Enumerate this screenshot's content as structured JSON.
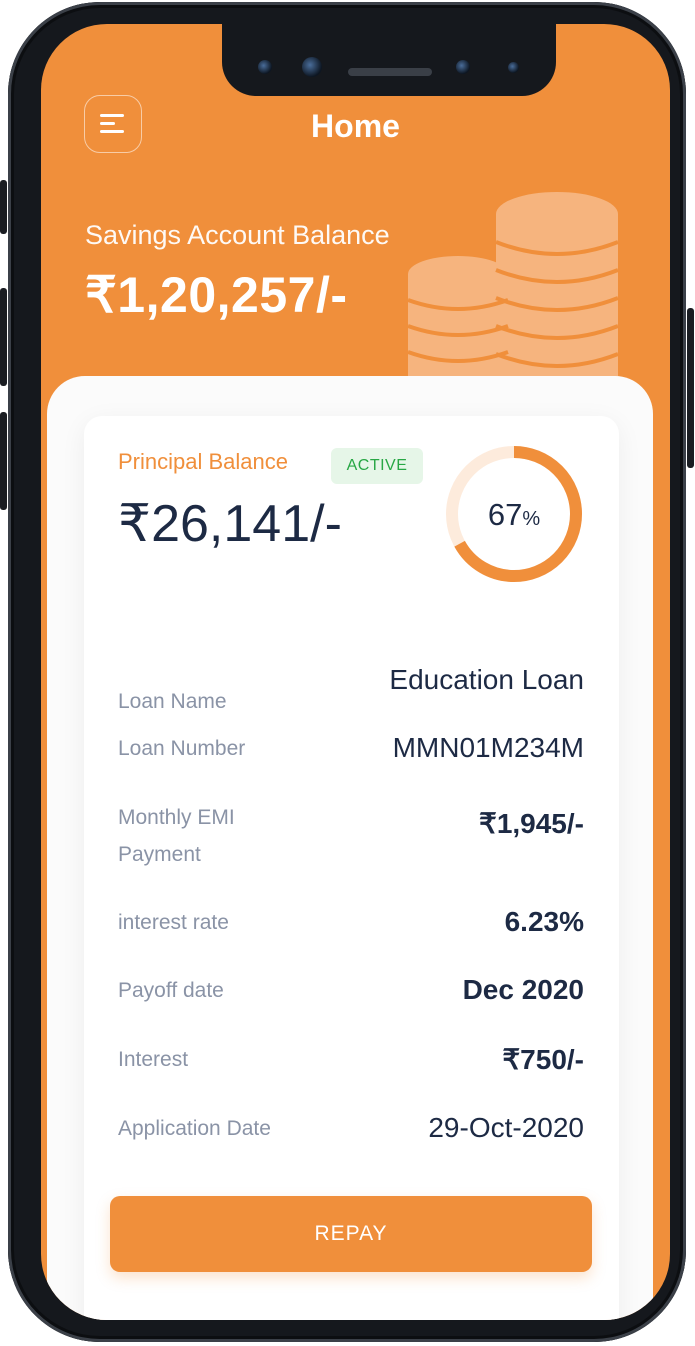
{
  "header": {
    "title": "Home"
  },
  "savings": {
    "label": "Savings Account Balance",
    "amount": "₹1,20,257/-"
  },
  "loan": {
    "principal_label": "Principal Balance",
    "status": "ACTIVE",
    "principal_amount": "₹26,141/-",
    "progress_percent": 67,
    "progress_number": "67",
    "progress_unit": "%"
  },
  "details": [
    {
      "label": "Loan Name",
      "value": "Education Loan"
    },
    {
      "label": "Loan Number",
      "value": "MMN01M234M"
    },
    {
      "label": "Monthly EMI Payment",
      "value": "₹1,945/-"
    },
    {
      "label": "interest rate",
      "value": "6.23%"
    },
    {
      "label": "Payoff date",
      "value": "Dec 2020"
    },
    {
      "label": "Interest",
      "value": "₹750/-"
    },
    {
      "label": "Application Date",
      "value": "29-Oct-2020"
    }
  ],
  "actions": {
    "repay_label": "REPAY"
  },
  "icons": {
    "menu": "menu-icon",
    "coins": "coins-illustration"
  },
  "colors": {
    "accent": "#f08f3b",
    "status_active": "#28a745",
    "status_active_bg": "#e6f6e8",
    "text_dark": "#1d2a44",
    "text_muted": "#8a93a6"
  }
}
